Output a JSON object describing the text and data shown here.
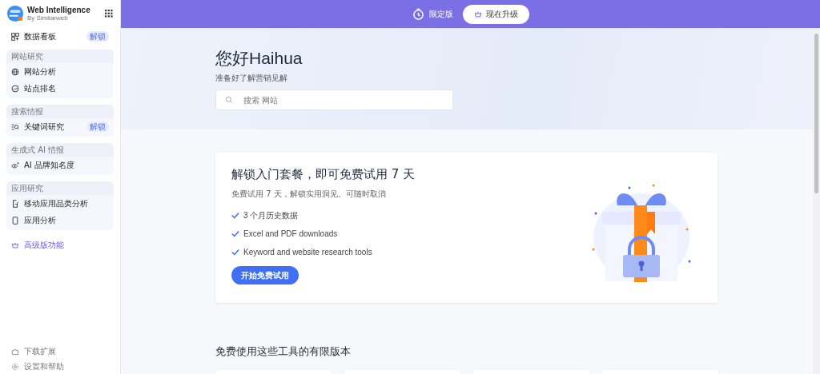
{
  "sidebar": {
    "logo": {
      "title": "Web Intelligence",
      "subtitle": "By Similarweb"
    },
    "top_items": [
      {
        "label": "数据看板",
        "badge": "解锁"
      }
    ],
    "sections": [
      {
        "heading": "网站研究",
        "items": [
          {
            "label": "网站分析"
          },
          {
            "label": "站点排名"
          }
        ]
      },
      {
        "heading": "搜索情报",
        "items": [
          {
            "label": "关键词研究",
            "badge": "解锁"
          }
        ]
      },
      {
        "heading": "生成式 AI 情报",
        "items": [
          {
            "label": "AI 品牌知名度"
          }
        ]
      },
      {
        "heading": "应用研究",
        "items": [
          {
            "label": "移动应用品类分析"
          },
          {
            "label": "应用分析"
          }
        ]
      }
    ],
    "premium": "高级版功能",
    "footer": [
      {
        "label": "下载扩展"
      },
      {
        "label": "设置和帮助"
      }
    ]
  },
  "topbar": {
    "plan": "限定版",
    "upgrade": "现在升级"
  },
  "hero": {
    "greeting": "您好Haihua",
    "subtitle": "准备好了解营销见解",
    "search": {
      "placeholder": "搜索 网站"
    }
  },
  "promo": {
    "title": "解锁入门套餐，即可免费试用 7 天",
    "subtitle": "免费试用 7 天，解锁实用洞见。可随时取消",
    "features": [
      "3 个月历史数据",
      "Excel and PDF downloads",
      "Keyword and website research tools"
    ],
    "button": "开始免费试用"
  },
  "tools": {
    "title": "免费使用这些工具的有限版本"
  }
}
